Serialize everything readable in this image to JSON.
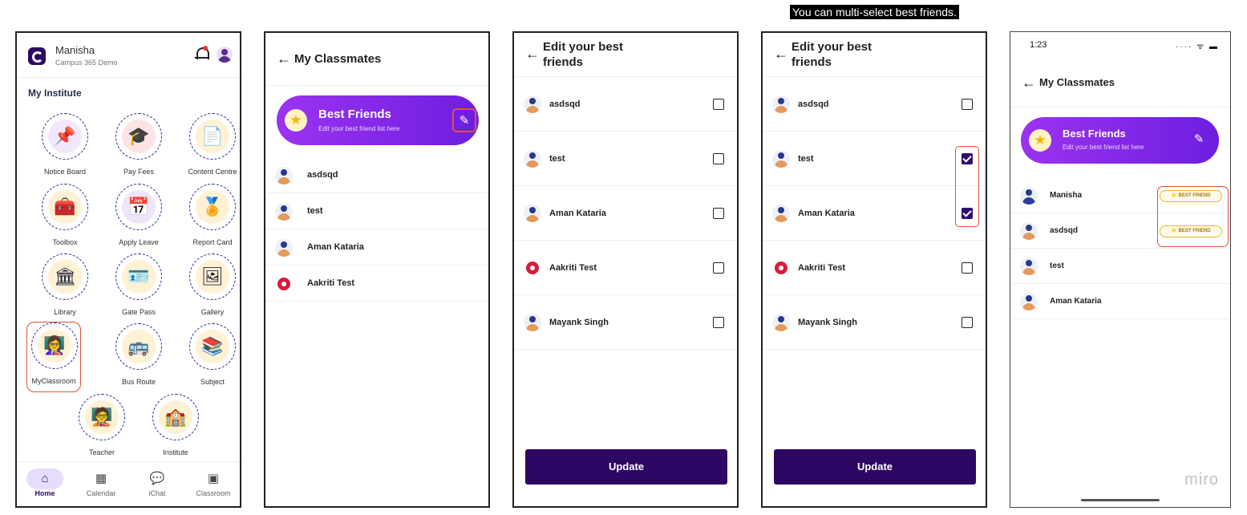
{
  "caption": "You can multi-select best friends.",
  "home": {
    "user_name": "Manisha",
    "user_sub": "Campus 365 Demo",
    "section_title": "My Institute",
    "tiles": [
      {
        "label": "Notice Board",
        "icon": "notice-board-icon",
        "glyph": "📌"
      },
      {
        "label": "Pay Fees",
        "icon": "graduation-cap-icon",
        "glyph": "🎓"
      },
      {
        "label": "Content Centre",
        "icon": "content-document-icon",
        "glyph": "📄"
      },
      {
        "label": "Toolbox",
        "icon": "toolbox-icon",
        "glyph": "🧰"
      },
      {
        "label": "Apply Leave",
        "icon": "calendar-leave-icon",
        "glyph": "📅"
      },
      {
        "label": "Report Card",
        "icon": "report-card-icon",
        "glyph": "🏅"
      },
      {
        "label": "Library",
        "icon": "library-icon",
        "glyph": "🏛"
      },
      {
        "label": "Gate Pass",
        "icon": "gate-pass-icon",
        "glyph": "🪪"
      },
      {
        "label": "Gallery",
        "icon": "gallery-icon",
        "glyph": "🖼"
      },
      {
        "label": "MyClassroom",
        "icon": "classroom-icon",
        "glyph": "👩‍🏫"
      },
      {
        "label": "Bus Route",
        "icon": "bus-icon",
        "glyph": "🚌"
      },
      {
        "label": "Subject",
        "icon": "books-icon",
        "glyph": "📚"
      },
      {
        "label": "Teacher",
        "icon": "teacher-icon",
        "glyph": "🧑‍🏫"
      },
      {
        "label": "Institute",
        "icon": "institute-building-icon",
        "glyph": "🏫"
      }
    ],
    "nav": [
      {
        "label": "Home",
        "icon": "home-icon",
        "glyph": "⌂"
      },
      {
        "label": "Calendar",
        "icon": "calendar-icon",
        "glyph": "▦"
      },
      {
        "label": "iChat",
        "icon": "chat-icon",
        "glyph": "💬"
      },
      {
        "label": "Classroom",
        "icon": "classroom-nav-icon",
        "glyph": "▣"
      }
    ]
  },
  "classmates": {
    "title": "My Classmates",
    "best_friends_title": "Best Friends",
    "best_friends_sub": "Edit your best friend list here",
    "students": [
      "asdsqd",
      "test",
      "Aman Kataria",
      "Aakriti Test"
    ]
  },
  "edit": {
    "title": "Edit your best friends",
    "students": [
      "asdsqd",
      "test",
      "Aman Kataria",
      "Aakriti Test",
      "Mayank Singh"
    ],
    "update_label": "Update",
    "unchecked": [
      false,
      false,
      false,
      false,
      false
    ],
    "checked": [
      false,
      true,
      true,
      false,
      false
    ]
  },
  "result": {
    "time": "1:23",
    "status": "···· ᯤ ▬",
    "title": "My Classmates",
    "best_friends_title": "Best Friends",
    "best_friends_sub": "Edit your best friend list here",
    "students": [
      "Manisha",
      "asdsqd",
      "test",
      "Aman Kataria"
    ],
    "badge_label": "⭐ BEST FRIEND",
    "watermark": "miro"
  },
  "colors": {
    "accent": "#2e0764",
    "gradient_start": "#9b33f0",
    "gradient_end": "#6d1ee0",
    "highlight": "#e0523a"
  }
}
